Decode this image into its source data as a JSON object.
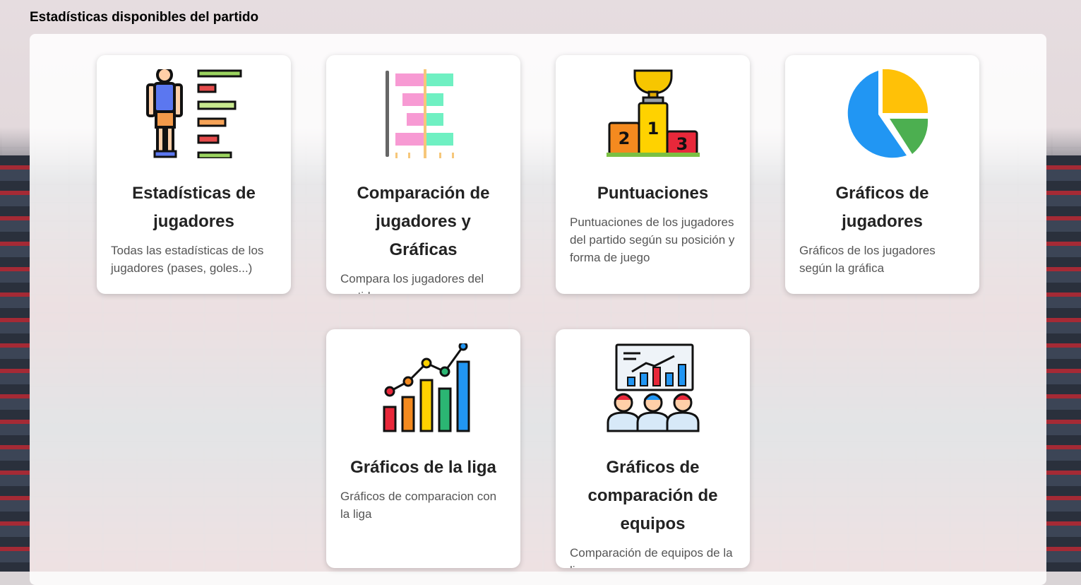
{
  "section_title": "Estadísticas disponibles del partido",
  "cards": [
    {
      "title": "Estadísticas de jugadores",
      "desc": "Todas las estadísticas de los jugadores (pases, goles...)",
      "icon": "player-stats-icon"
    },
    {
      "title": "Comparación de jugadores y Gráficas",
      "desc": "Compara los jugadores del partido para ver cosas que",
      "icon": "comparison-bars-icon"
    },
    {
      "title": "Puntuaciones",
      "desc": "Puntuaciones de los jugadores del partido según su posición y forma de juego",
      "icon": "podium-trophy-icon"
    },
    {
      "title": "Gráficos de jugadores",
      "desc": "Gráficos de los jugadores según la gráfica",
      "icon": "pie-chart-icon"
    },
    {
      "title": "Gráficos de la liga",
      "desc": "Gráficos de comparacion con la liga",
      "icon": "bar-line-chart-icon"
    },
    {
      "title": "Gráficos de comparación de equipos",
      "desc": "Comparación de equipos de la liga para ver cosas",
      "icon": "team-presentation-icon"
    }
  ],
  "podium_labels": [
    "2",
    "1",
    "3"
  ]
}
